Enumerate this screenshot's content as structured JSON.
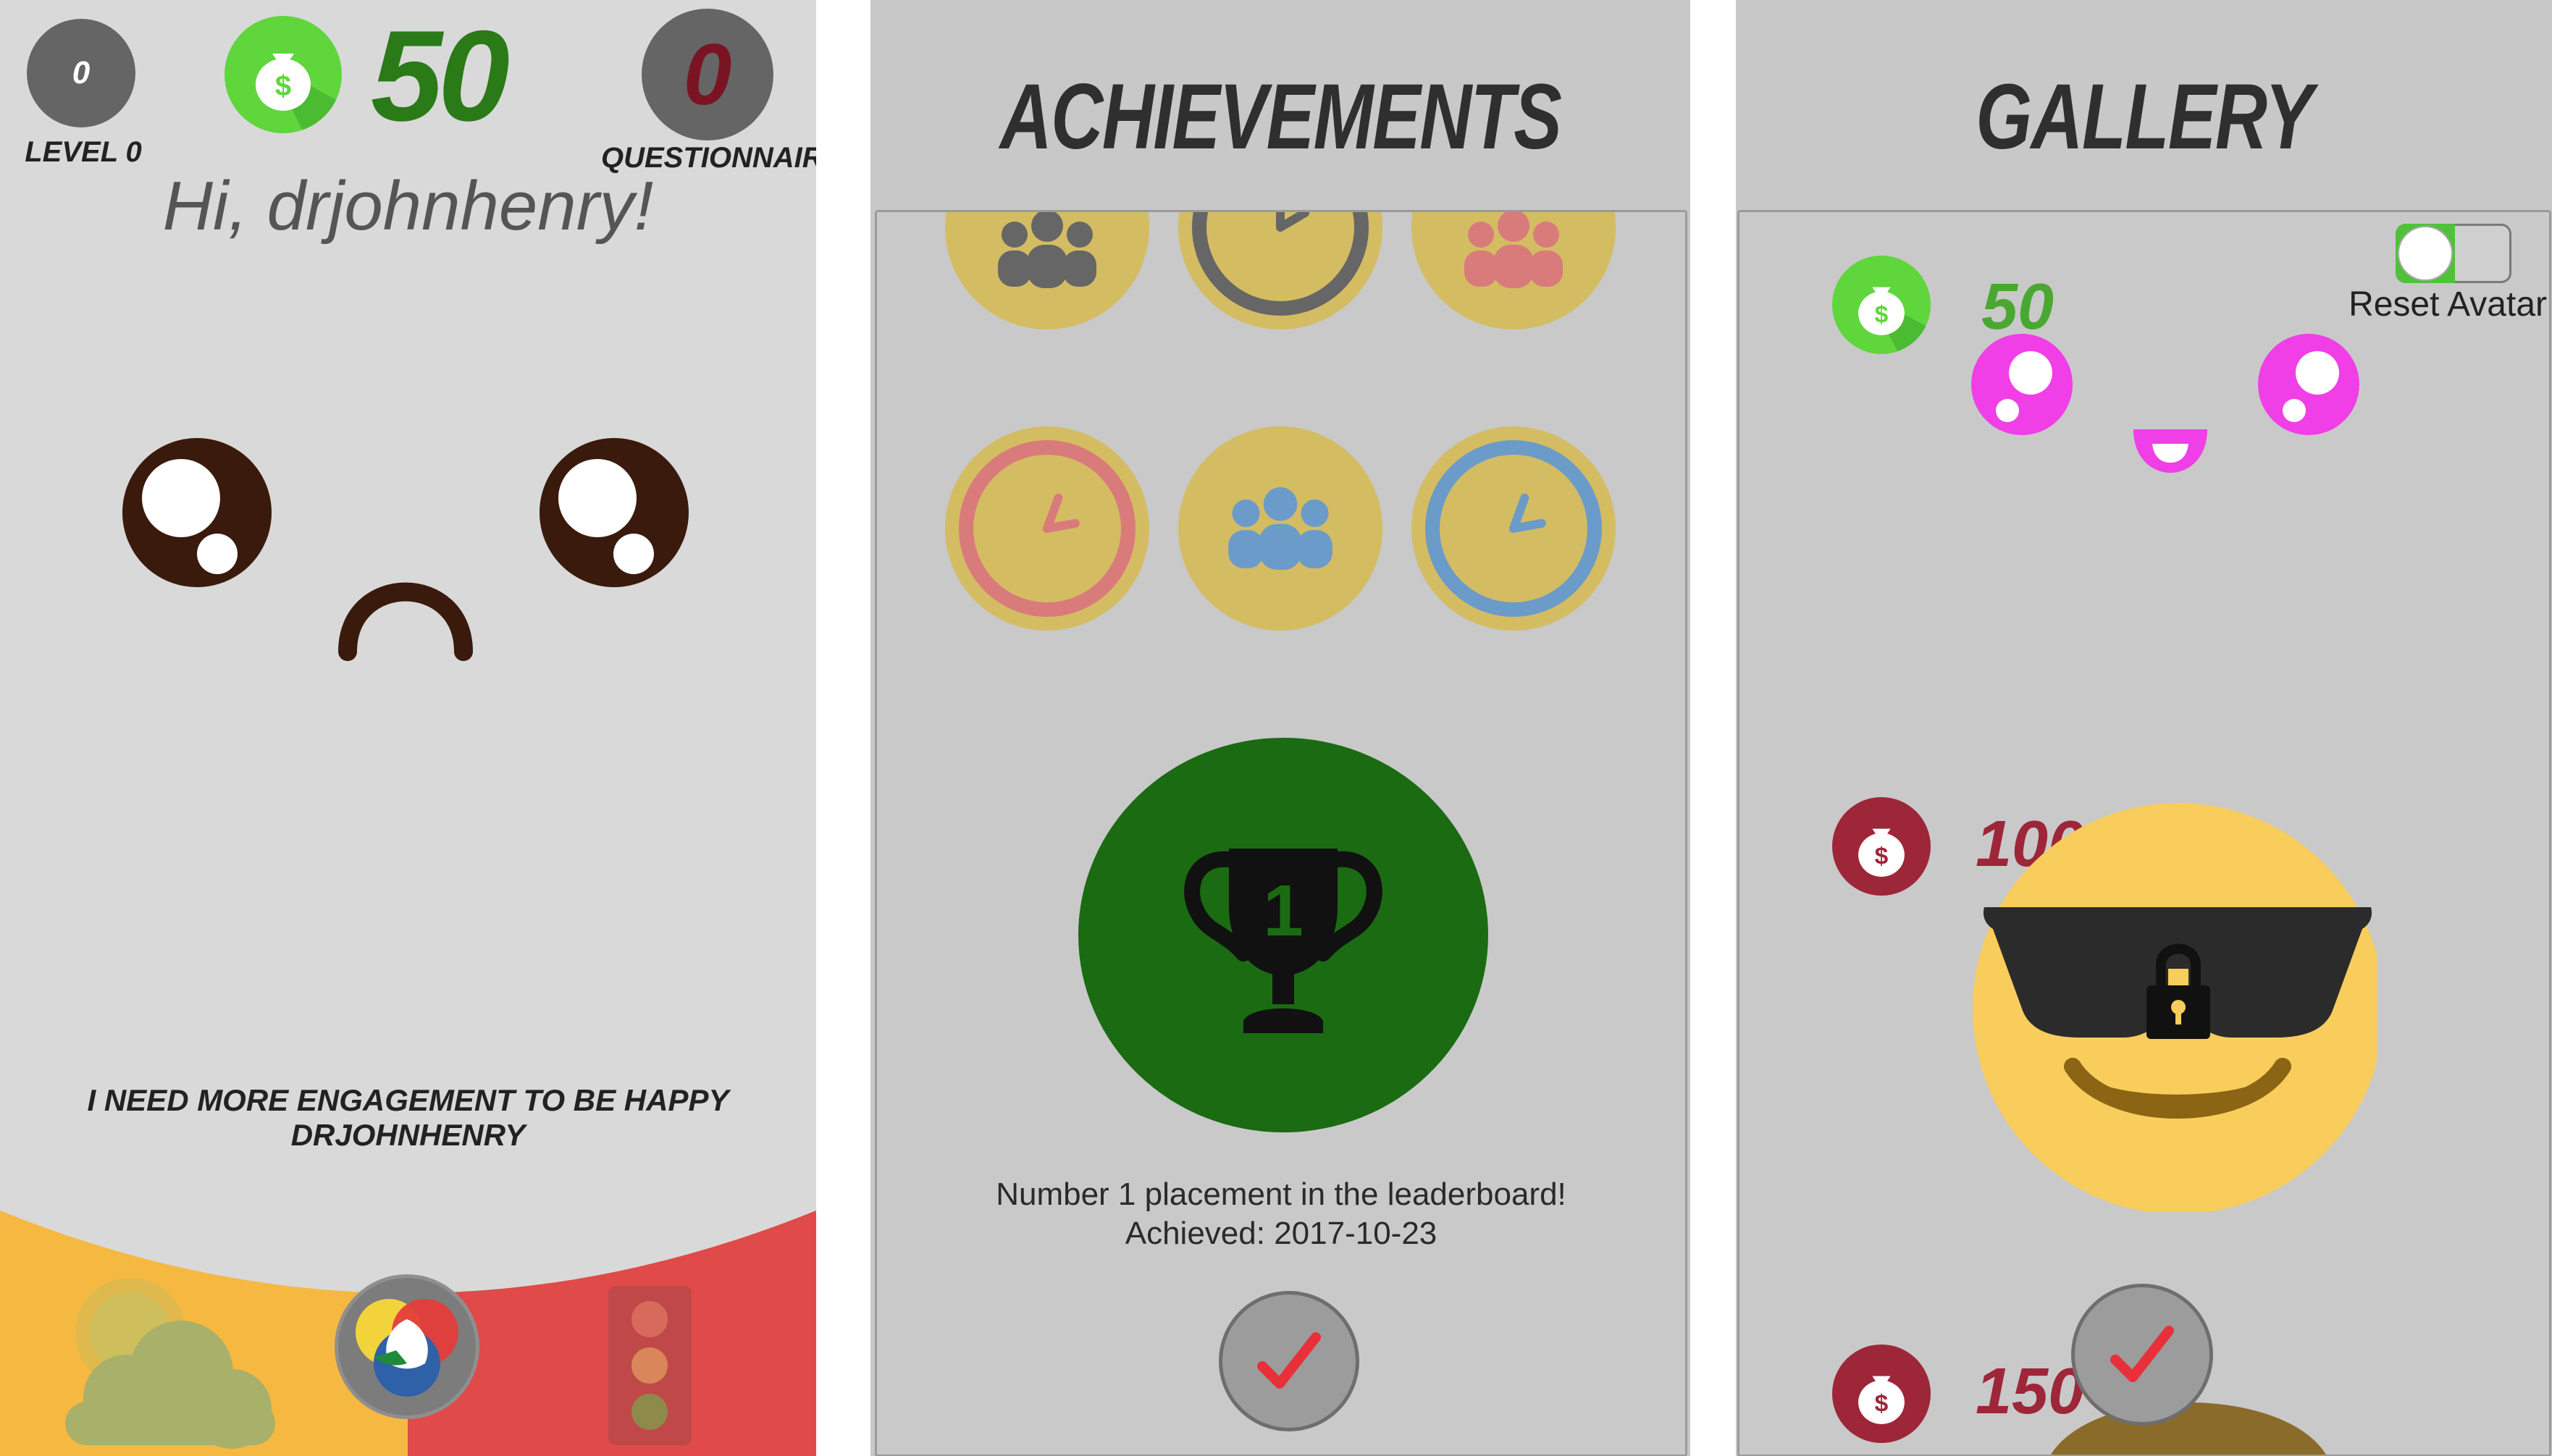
{
  "home": {
    "level_value": "0",
    "level_label": "LEVEL 0",
    "coins": "50",
    "questionnaires_value": "0",
    "questionnaires_label": "QUESTIONNAIRES",
    "greeting": "Hi, drjohnhenry!",
    "mood_message": "I NEED MORE ENGAGEMENT TO BE HAPPY DRJOHNHENRY",
    "bottom_nav": [
      "weather-icon",
      "color-wheel-icon",
      "traffic-light-icon"
    ]
  },
  "achievements": {
    "title": "ACHIEVEMENTS",
    "badges": [
      {
        "icon": "people-icon",
        "color": "#666666"
      },
      {
        "icon": "clock-icon",
        "color": "#666666"
      },
      {
        "icon": "people-icon",
        "color": "#d97b7b"
      },
      {
        "icon": "clock-icon",
        "color": "#d97b7b"
      },
      {
        "icon": "people-icon",
        "color": "#6b9bc8"
      },
      {
        "icon": "clock-icon",
        "color": "#6b9bc8"
      }
    ],
    "featured_icon": "trophy-icon",
    "featured_number": "1",
    "description": "Number 1 placement in the leaderboard!",
    "achieved": "Achieved: 2017-10-23"
  },
  "gallery": {
    "title": "GALLERY",
    "reset_label": "Reset Avatar",
    "items": [
      {
        "price": "50",
        "locked": false,
        "color": "#5fd63c"
      },
      {
        "price": "100",
        "locked": true,
        "color": "#9e2639"
      },
      {
        "price": "150",
        "locked": true,
        "color": "#9e2639"
      }
    ]
  },
  "colors": {
    "money_green": "#5fd63c",
    "money_red": "#9e2639",
    "trophy_green": "#1a6b12",
    "badge_yellow": "#d4bc63",
    "warm_yellow": "#f5b942",
    "warm_red": "#e04a48",
    "check_red": "#e8303a"
  }
}
